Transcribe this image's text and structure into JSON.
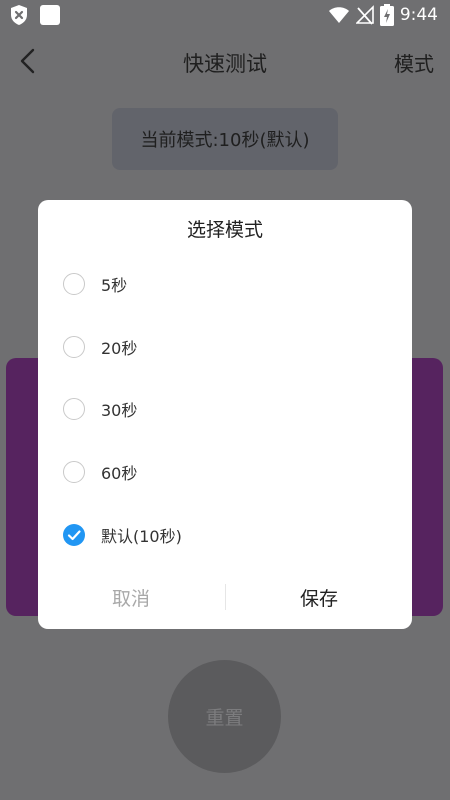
{
  "status_bar": {
    "time": "9:44",
    "left_icons": [
      "shield-x-icon",
      "app-square-icon"
    ],
    "right_icons": [
      "wifi-icon",
      "no-signal-icon",
      "battery-charging-icon"
    ]
  },
  "header": {
    "title": "快速测试",
    "mode_label": "模式",
    "back_icon": "chevron-left-icon"
  },
  "mode_display": "当前模式:10秒(默认)",
  "reset_label": "重置",
  "dialog": {
    "title": "选择模式",
    "options": [
      {
        "label": "5秒",
        "checked": false
      },
      {
        "label": "20秒",
        "checked": false
      },
      {
        "label": "30秒",
        "checked": false
      },
      {
        "label": "60秒",
        "checked": false
      },
      {
        "label": "默认(10秒)",
        "checked": true
      }
    ],
    "cancel_label": "取消",
    "save_label": "保存"
  },
  "colors": {
    "accent": "#2196f3",
    "panel": "#56235f",
    "overlay_bg": "#6f6f71"
  }
}
